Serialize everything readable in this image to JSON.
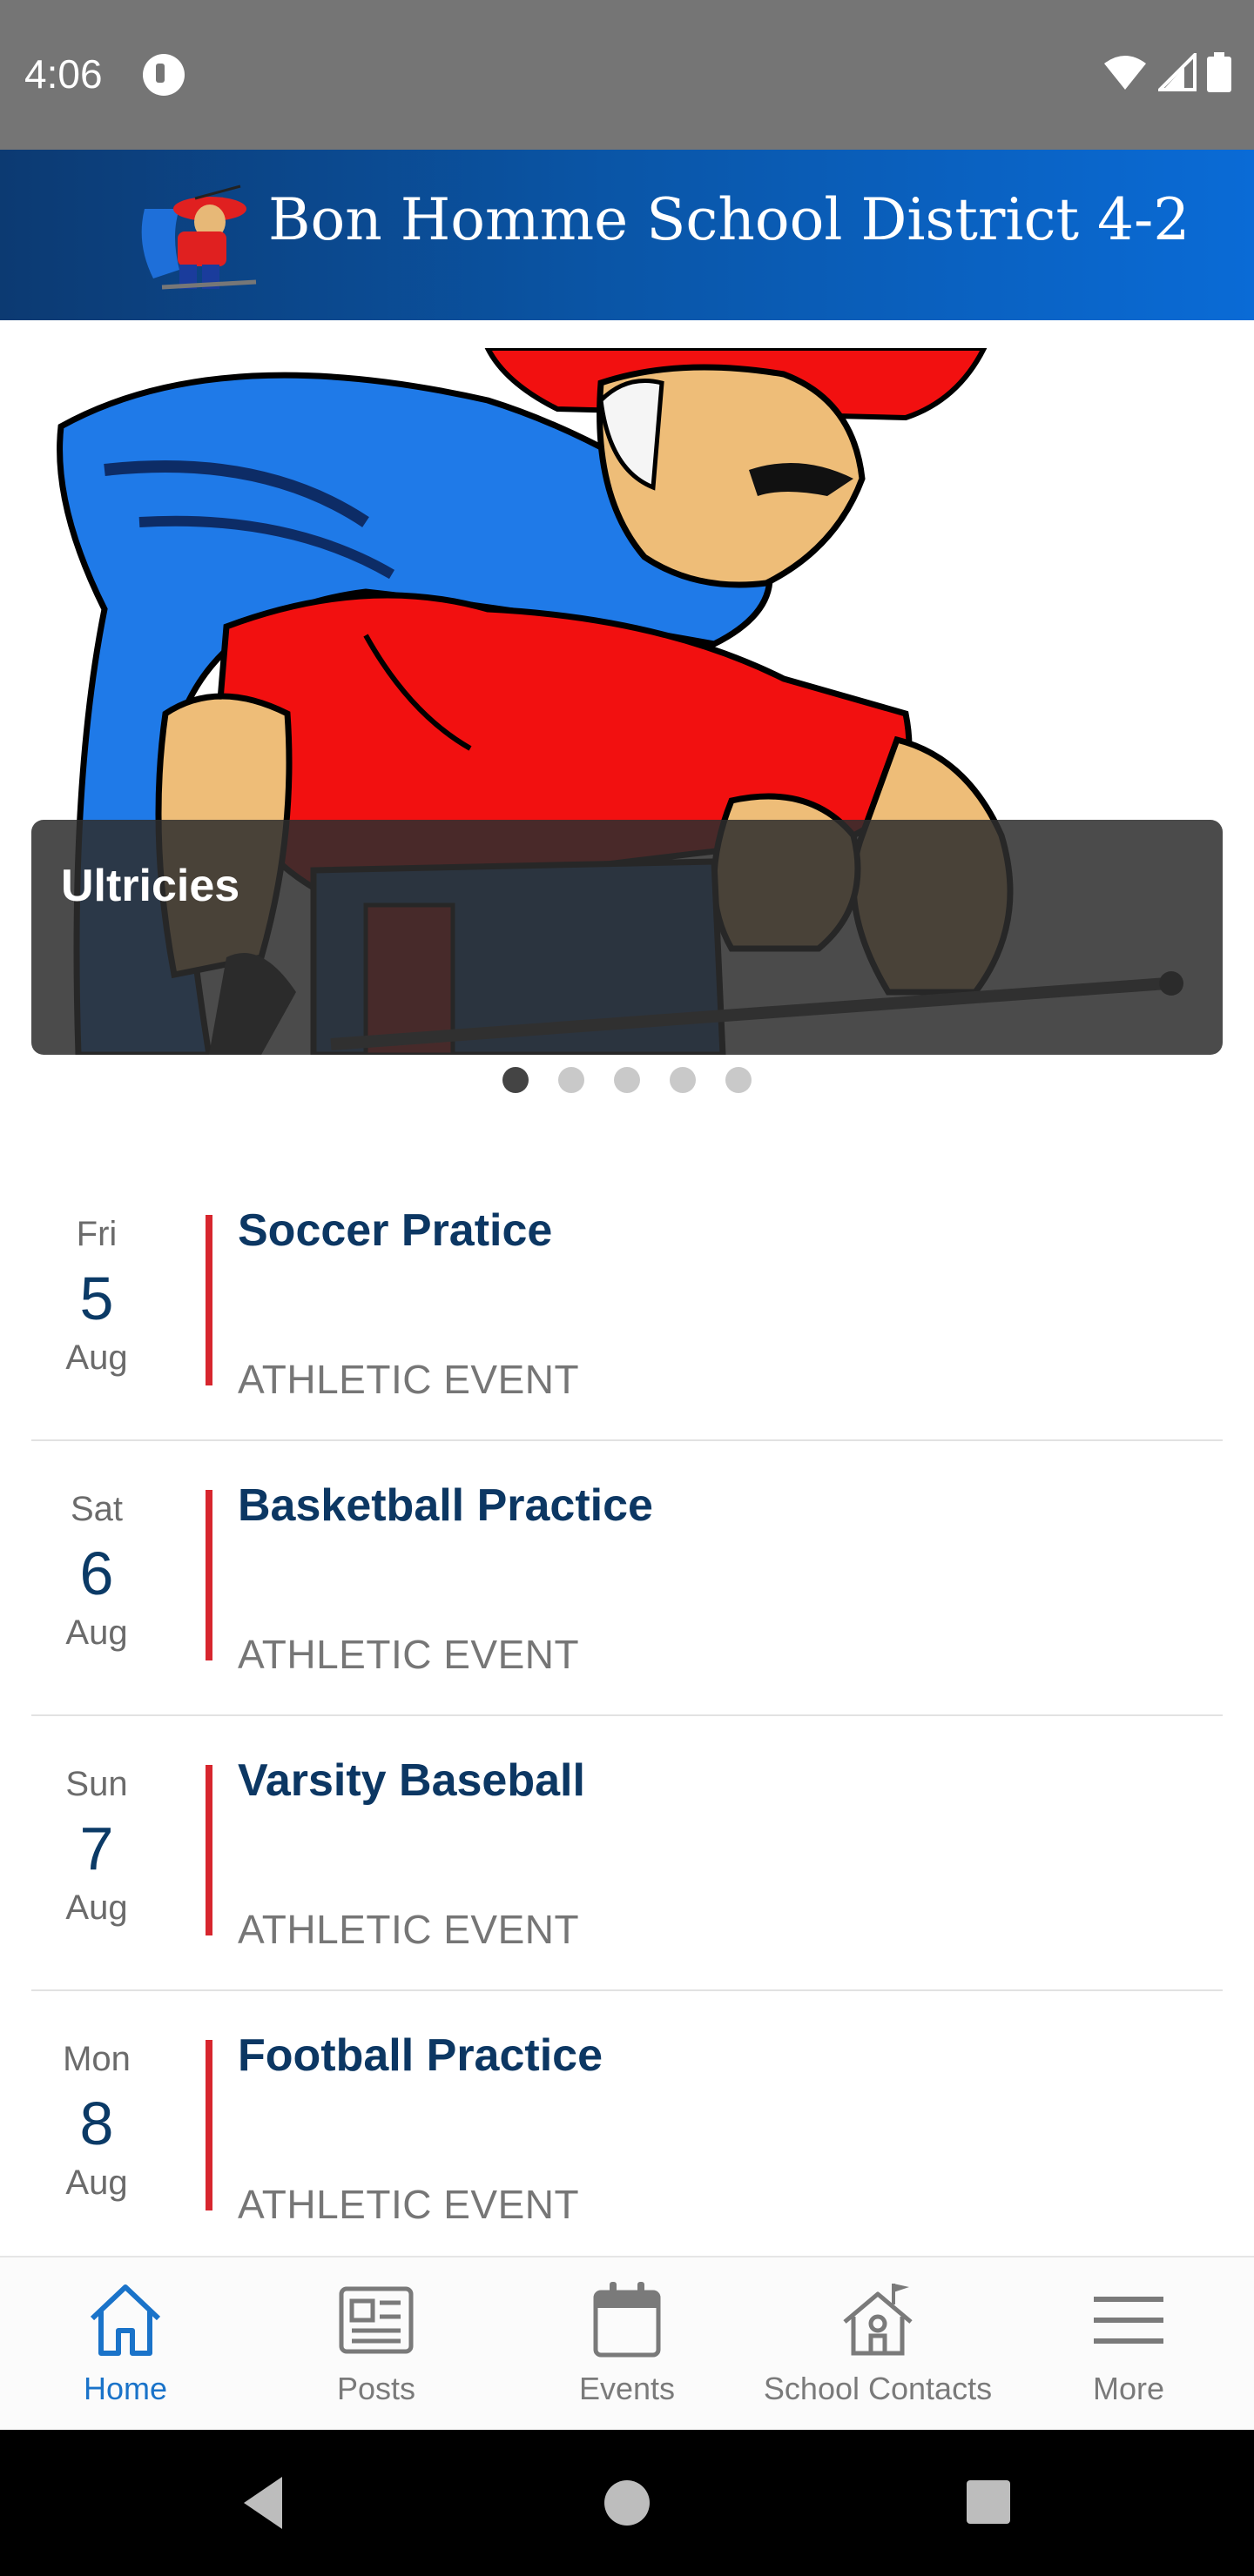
{
  "status_bar": {
    "time": "4:06"
  },
  "header": {
    "title": "Bon Homme School District 4-2"
  },
  "carousel": {
    "caption": "Ultricies",
    "total_slides": 5,
    "active_index": 0
  },
  "events": [
    {
      "dow": "Fri",
      "day": "5",
      "month": "Aug",
      "title": "Soccer Pratice",
      "category": "ATHLETIC EVENT"
    },
    {
      "dow": "Sat",
      "day": "6",
      "month": "Aug",
      "title": "Basketball Practice",
      "category": "ATHLETIC EVENT"
    },
    {
      "dow": "Sun",
      "day": "7",
      "month": "Aug",
      "title": "Varsity Baseball",
      "category": "ATHLETIC EVENT"
    },
    {
      "dow": "Mon",
      "day": "8",
      "month": "Aug",
      "title": "Football Practice",
      "category": "ATHLETIC EVENT"
    }
  ],
  "bottom_nav": {
    "home": "Home",
    "posts": "Posts",
    "events": "Events",
    "contacts": "School Contacts",
    "more": "More",
    "active": "home"
  },
  "colors": {
    "accent_blue": "#1a73c9",
    "event_bar_red": "#d7262e",
    "title_navy": "#0c3763"
  }
}
